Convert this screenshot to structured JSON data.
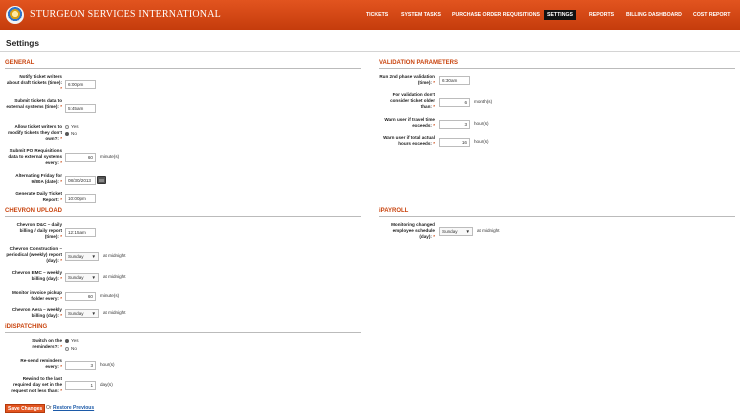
{
  "brand": "Sturgeon Services International",
  "nav": [
    "TICKETS",
    "SYSTEM TASKS",
    "PURCHASE ORDER REQUISITIONS",
    "SETTINGS",
    "REPORTS",
    "BILLING DASHBOARD",
    "COST REPORT"
  ],
  "page_title": "Settings",
  "general": {
    "heading": "GENERAL",
    "notify_label": "Notify ticket writers about draft tickets (time):",
    "notify_value": "6:00pm",
    "submit_label": "Submit tickets data to external systems (time):",
    "submit_value": "5:45am",
    "allow_label": "Allow ticket writers to modify tickets they don't own?:",
    "allow_yes": "Yes",
    "allow_no": "No",
    "po_label": "Submit PO Requisitions data to external systems every:",
    "po_value": "60",
    "po_unit": "minute(s)",
    "friday_label": "Alternating Friday for 9/80A (date):",
    "friday_value": "08/30/2013",
    "daily_label": "Generate Daily Ticket Report:",
    "daily_value": "10:00pm",
    "req": "*"
  },
  "chevron": {
    "heading": "CHEVRON UPLOAD",
    "dac_label": "Chevron D&C – daily billing / daily report (time):",
    "dac_value": "12:15am",
    "construction_label": "Chevron Construction – periodical (weekly) report (day):",
    "construction_value": "Sunday",
    "construction_unit": "at midnight",
    "emc_label": "Chevron EMC – weekly billing (day):",
    "emc_value": "Sunday",
    "emc_unit": "at midnight",
    "monitor_label": "Monitor invoice pickup folder every:",
    "monitor_value": "60",
    "monitor_unit": "minute(s)",
    "aera_label": "Chevron Aera – weekly billing (day):",
    "aera_value": "Sunday",
    "aera_unit": "at midnight"
  },
  "dispatching": {
    "heading": "iDISPATCHING",
    "switch_label": "Switch on the reminders?:",
    "switch_yes": "Yes",
    "switch_no": "No",
    "resend_label": "Re-send reminders every:",
    "resend_value": "3",
    "resend_unit": "hour(s)",
    "rewind_label": "Rewind to the last required day set in the request not less than:",
    "rewind_value": "1",
    "rewind_unit": "day(s)"
  },
  "validation": {
    "heading": "VALIDATION PARAMETERS",
    "run_label": "Run 2nd phase validation (time):",
    "run_value": "6:30am",
    "older_label": "For validation don't consider ticket older than:",
    "older_value": "6",
    "older_unit": "month(s)",
    "travel_label": "Warn user if travel time exceeds:",
    "travel_value": "3",
    "travel_unit": "hour(s)",
    "actual_label": "Warn user if total actual hours exceeds:",
    "actual_value": "16",
    "actual_unit": "hour(s)"
  },
  "payroll": {
    "heading": "iPAYROLL",
    "monitor_label": "Monitoring changed employee schedule (day):",
    "monitor_value": "Sunday",
    "monitor_unit": "at midnight"
  },
  "footer": {
    "save": "Save Changes",
    "or": "Or",
    "restore": "Restore Previous"
  }
}
